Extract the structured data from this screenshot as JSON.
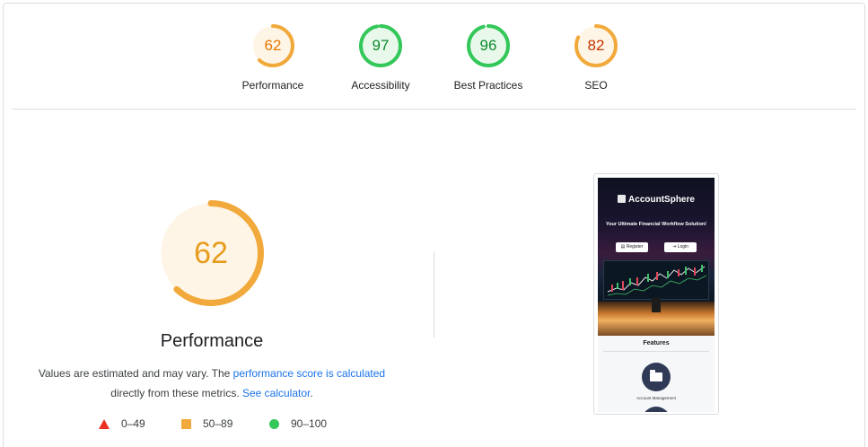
{
  "gauges": [
    {
      "score": "62",
      "label": "Performance",
      "color": "#e67700",
      "ring": "#f2a93b",
      "bg": "#fff5e6",
      "value": 0.62
    },
    {
      "score": "97",
      "label": "Accessibility",
      "color": "#0d8a2b",
      "ring": "#34c759",
      "bg": "#e8f9ec",
      "value": 0.97
    },
    {
      "score": "96",
      "label": "Best Practices",
      "color": "#0d8a2b",
      "ring": "#34c759",
      "bg": "#e8f9ec",
      "value": 0.96
    },
    {
      "score": "82",
      "label": "SEO",
      "color": "#c33300",
      "ring": "#f2a93b",
      "bg": "#fff5e6",
      "value": 0.82
    }
  ],
  "main": {
    "score": "62",
    "title": "Performance",
    "value": 0.62,
    "desc_prefix": "Values are estimated and may vary. The ",
    "desc_link1": "performance score is calculated",
    "desc_middle": " directly from these metrics. ",
    "desc_link2": "See calculator",
    "desc_suffix": "."
  },
  "legend": [
    {
      "icon": "triangle-icon",
      "range": "0–49",
      "color": "#eb3223"
    },
    {
      "icon": "square-icon",
      "range": "50–89",
      "color": "#f2a93b"
    },
    {
      "icon": "circle-icon",
      "range": "90–100",
      "color": "#34c759"
    }
  ],
  "screenshot": {
    "brand": "AccountSphere",
    "tagline": "Your Ultimate Financial Workflow Solution!",
    "register": "Register",
    "login": "Login",
    "features": "Features",
    "feature1": "Account Management"
  }
}
